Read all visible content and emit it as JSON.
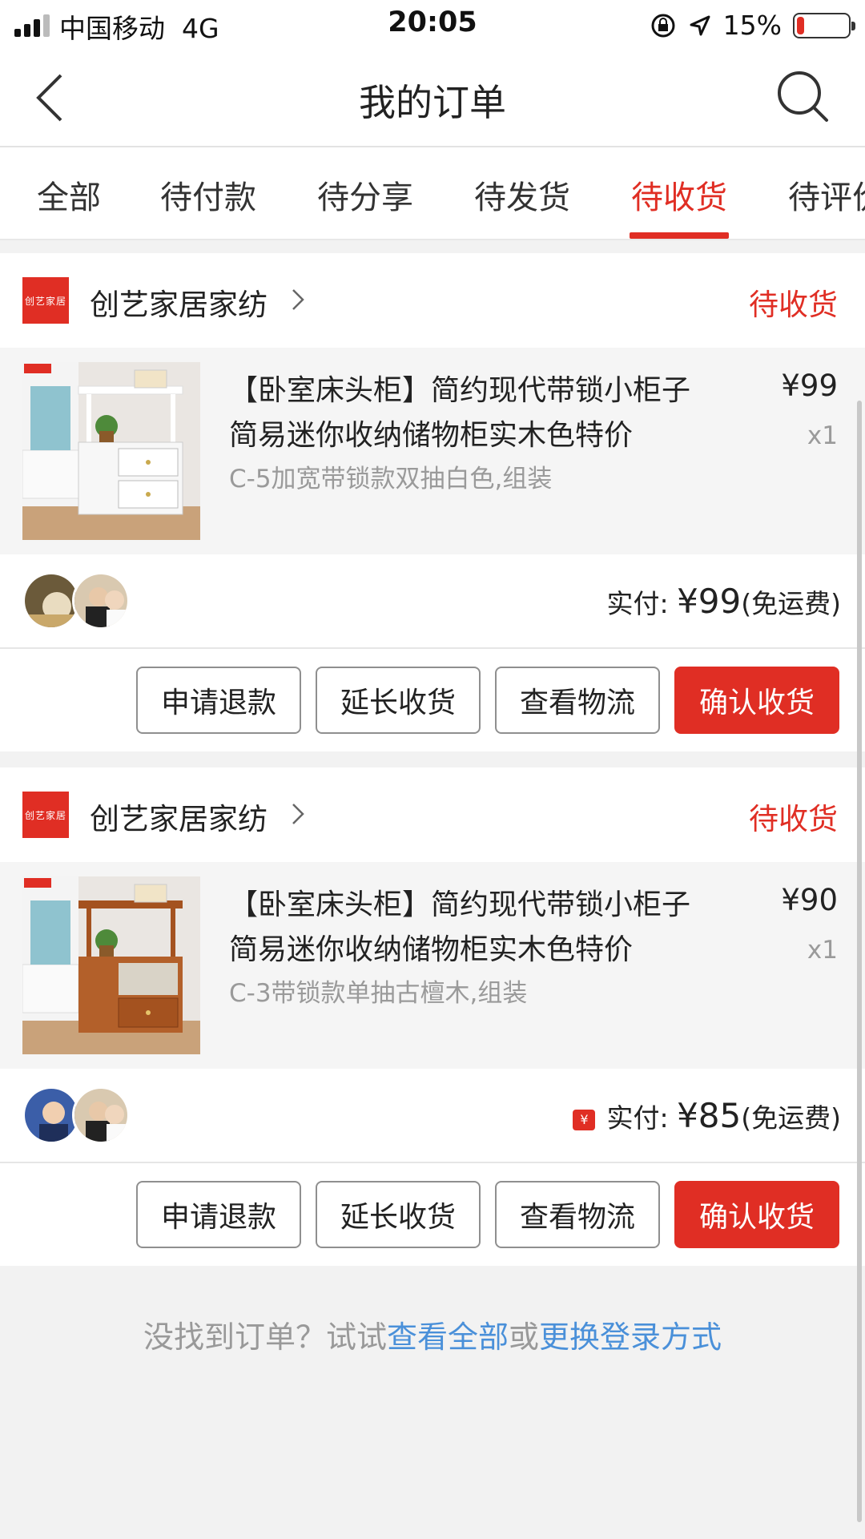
{
  "status_bar": {
    "carrier": "中国移动",
    "network": "4G",
    "time": "20:05",
    "battery": "15%",
    "battery_level": 0.15
  },
  "nav": {
    "title": "我的订单"
  },
  "tabs": [
    {
      "label": "全部",
      "active": false
    },
    {
      "label": "待付款",
      "active": false
    },
    {
      "label": "待分享",
      "active": false
    },
    {
      "label": "待发货",
      "active": false
    },
    {
      "label": "待收货",
      "active": true
    },
    {
      "label": "待评价",
      "active": false
    }
  ],
  "orders": [
    {
      "shop_logo_text": "创艺家居",
      "shop_name": "创艺家居家纺",
      "status": "待收货",
      "product_title": "【卧室床头柜】简约现代带锁小柜子简易迷你收纳储物柜实木色特价",
      "spec": "C-5加宽带锁款双抽白色,组装",
      "price": "¥99",
      "qty": "x1",
      "pay_label": "实付: ",
      "pay_amount": "¥99",
      "pay_note": "(免运费)",
      "buttons": [
        "申请退款",
        "延长收货",
        "查看物流",
        "确认收货"
      ]
    },
    {
      "shop_logo_text": "创艺家居",
      "shop_name": "创艺家居家纺",
      "status": "待收货",
      "product_title": "【卧室床头柜】简约现代带锁小柜子简易迷你收纳储物柜实木色特价",
      "spec": "C-3带锁款单抽古檀木,组装",
      "price": "¥90",
      "qty": "x1",
      "coupon_icon": "¥",
      "pay_label": "实付: ",
      "pay_amount": "¥85",
      "pay_note": "(免运费)",
      "buttons": [
        "申请退款",
        "延长收货",
        "查看物流",
        "确认收货"
      ]
    }
  ],
  "footer": {
    "prefix": "没找到订单？试试",
    "link1": "查看全部",
    "middle": "或",
    "link2": "更换登录方式"
  },
  "colors": {
    "accent": "#e02e24",
    "link": "#4a90d9",
    "muted": "#9a9a9a"
  }
}
